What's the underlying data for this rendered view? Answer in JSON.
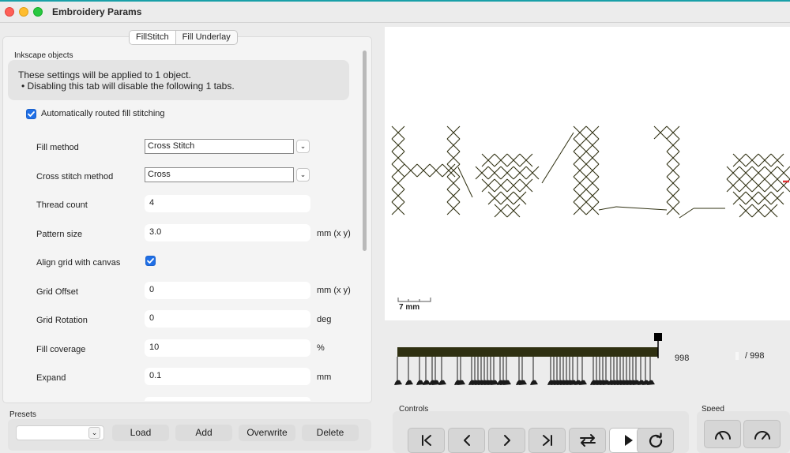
{
  "window": {
    "title": "Embroidery Params"
  },
  "tabs": [
    {
      "label": "FillStitch"
    },
    {
      "label": "Fill Underlay"
    }
  ],
  "section": {
    "label": "Inkscape objects"
  },
  "info": {
    "line1": "These settings will be applied to 1 object.",
    "line2": "• Disabling this tab will disable the following 1 tabs."
  },
  "auto_route": {
    "label": "Automatically routed fill stitching",
    "checked": true
  },
  "params": {
    "fill_method": {
      "label": "Fill method",
      "value": "Cross Stitch"
    },
    "cross_stitch_method": {
      "label": "Cross stitch method",
      "value": "Cross"
    },
    "thread_count": {
      "label": "Thread count",
      "value": "4"
    },
    "pattern_size": {
      "label": "Pattern size",
      "value": "3.0",
      "unit": "mm (x y)"
    },
    "align_grid": {
      "label": "Align grid with canvas",
      "checked": true
    },
    "grid_offset": {
      "label": "Grid Offset",
      "value": "0",
      "unit": "mm (x y)"
    },
    "grid_rotation": {
      "label": "Grid Rotation",
      "value": "0",
      "unit": "deg"
    },
    "fill_coverage": {
      "label": "Fill coverage",
      "value": "10",
      "unit": "%"
    },
    "expand": {
      "label": "Expand",
      "value": "0.1",
      "unit": "mm"
    }
  },
  "presets": {
    "label": "Presets",
    "selected": "",
    "buttons": {
      "load": "Load",
      "add": "Add",
      "overwrite": "Overwrite",
      "delete": "Delete"
    }
  },
  "preview": {
    "scale_label": "7 mm"
  },
  "timeline": {
    "current": "998",
    "total": "/ 998",
    "position": 1.0
  },
  "controls": {
    "label": "Controls"
  },
  "speed": {
    "label": "Speed"
  },
  "icons": {
    "first": "skip-to-start-icon",
    "prev": "chevron-left-icon",
    "next": "chevron-right-icon",
    "last": "skip-to-end-icon",
    "swap": "swap-arrows-icon",
    "play": "play-icon",
    "restart": "restart-icon",
    "slower": "speed-slow-icon",
    "faster": "speed-fast-icon"
  },
  "colors": {
    "accent": "#1f6fe6",
    "stitch": "#2f3011",
    "titlebar_accent": "#19a0a8"
  }
}
